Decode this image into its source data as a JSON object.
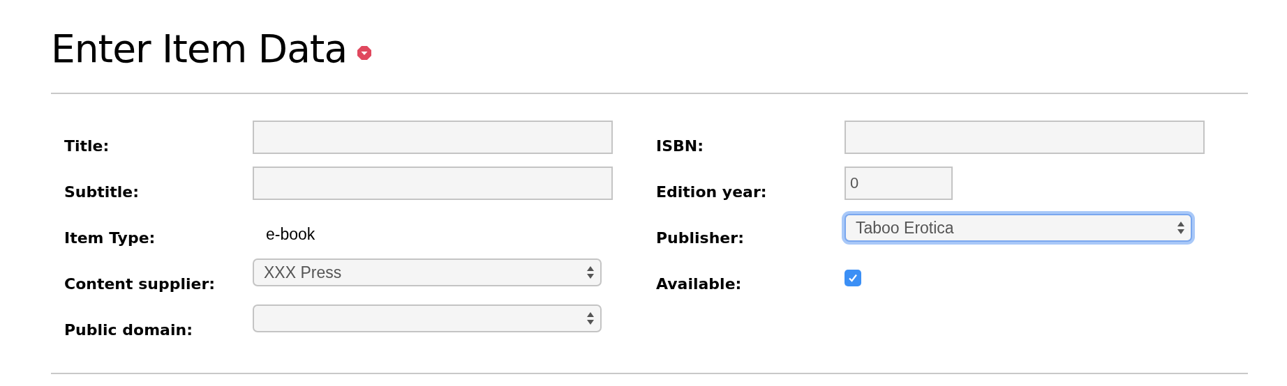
{
  "heading": {
    "title": "Enter Item Data",
    "collapsed": false
  },
  "columns": [
    {
      "fields": [
        {
          "label": "Title:",
          "kind": "text"
        },
        {
          "label": "Subtitle:",
          "kind": "text"
        },
        {
          "label": "Item Type:",
          "kind": "static",
          "value": "e-book"
        },
        {
          "label": "Content supplier:",
          "kind": "select",
          "value": "XXX Press",
          "focused": false
        },
        {
          "label": "Public domain:",
          "kind": "select",
          "focused": false
        }
      ]
    },
    {
      "fields": [
        {
          "label": "ISBN:",
          "kind": "text"
        },
        {
          "label": "Edition year:",
          "kind": "year",
          "value": "0"
        },
        {
          "label": "Publisher:",
          "kind": "select",
          "value": "Taboo Erotica",
          "focused": true
        },
        {
          "label": "Available:",
          "kind": "checkbox",
          "checked": true
        }
      ]
    }
  ]
}
